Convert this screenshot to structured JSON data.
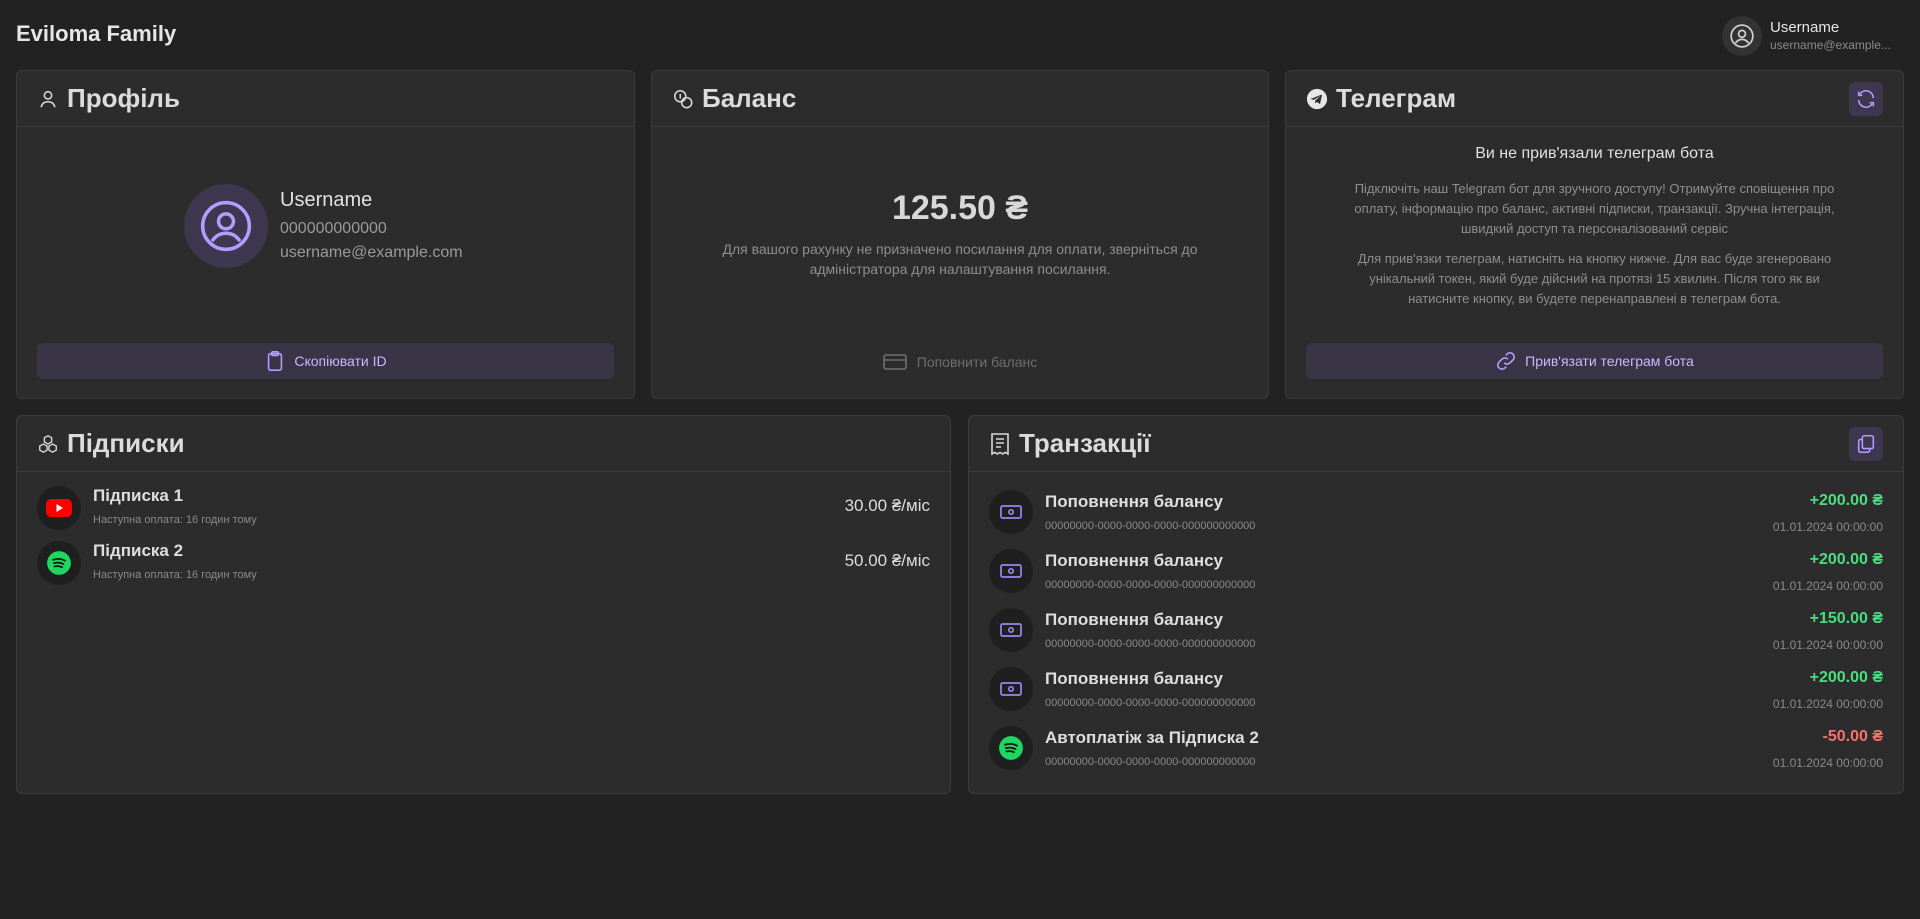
{
  "app": {
    "brand": "Eviloma Family"
  },
  "user": {
    "name": "Username",
    "email": "username@example..."
  },
  "profile": {
    "title": "Профіль",
    "name": "Username",
    "id": "000000000000",
    "email": "username@example.com",
    "copy_button": "Скопіювати ID"
  },
  "balance": {
    "title": "Баланс",
    "amount": "125.50 ₴",
    "note": "Для вашого рахунку не призначено посилання для оплати, зверніться до адміністратора для налаштування посилання.",
    "topup_button": "Поповнити баланс"
  },
  "telegram": {
    "title": "Телеграм",
    "status": "Ви не прив'язали телеграм бота",
    "text1": "Підключіть наш Telegram бот для зручного доступу! Отримуйте сповіщення про оплату, інформацію про баланс, активні підписки, транзакції. Зручна інтеграція, швидкий доступ та персоналізований сервіс",
    "text2": "Для прив'язки телеграм, натисніть на кнопку нижче. Для вас буде згенеровано унікальний токен, який буде дійсний на протязі 15 хвилин. Після того як ви натисните кнопку, ви будете перенаправлені в телеграм бота.",
    "link_button": "Прив'язати телеграм бота"
  },
  "subscriptions": {
    "title": "Підписки",
    "items": [
      {
        "name": "Підписка 1",
        "next": "Наступна оплата: 16 годин тому",
        "price": "30.00 ₴/міс",
        "icon": "youtube-icon"
      },
      {
        "name": "Підписка 2",
        "next": "Наступна оплата: 16 годин тому",
        "price": "50.00 ₴/міс",
        "icon": "spotify-icon"
      }
    ]
  },
  "transactions": {
    "title": "Транзакції",
    "items": [
      {
        "name": "Поповнення балансу",
        "id": "00000000-0000-0000-0000-000000000000",
        "amount": "+200.00 ₴",
        "date": "01.01.2024 00:00:00",
        "icon": "cash-icon"
      },
      {
        "name": "Поповнення балансу",
        "id": "00000000-0000-0000-0000-000000000000",
        "amount": "+200.00 ₴",
        "date": "01.01.2024 00:00:00",
        "icon": "cash-icon"
      },
      {
        "name": "Поповнення балансу",
        "id": "00000000-0000-0000-0000-000000000000",
        "amount": "+150.00 ₴",
        "date": "01.01.2024 00:00:00",
        "icon": "cash-icon"
      },
      {
        "name": "Поповнення балансу",
        "id": "00000000-0000-0000-0000-000000000000",
        "amount": "+200.00 ₴",
        "date": "01.01.2024 00:00:00",
        "icon": "cash-icon"
      },
      {
        "name": "Автоплатіж за Підписка 2",
        "id": "00000000-0000-0000-0000-000000000000",
        "amount": "-50.00 ₴",
        "date": "01.01.2024 00:00:00",
        "icon": "spotify-icon"
      }
    ]
  },
  "colors": {
    "accent": "#b39dff",
    "positive": "#4ade80",
    "negative": "#f87171",
    "youtube": "#ff0000",
    "spotify": "#1ed760"
  }
}
